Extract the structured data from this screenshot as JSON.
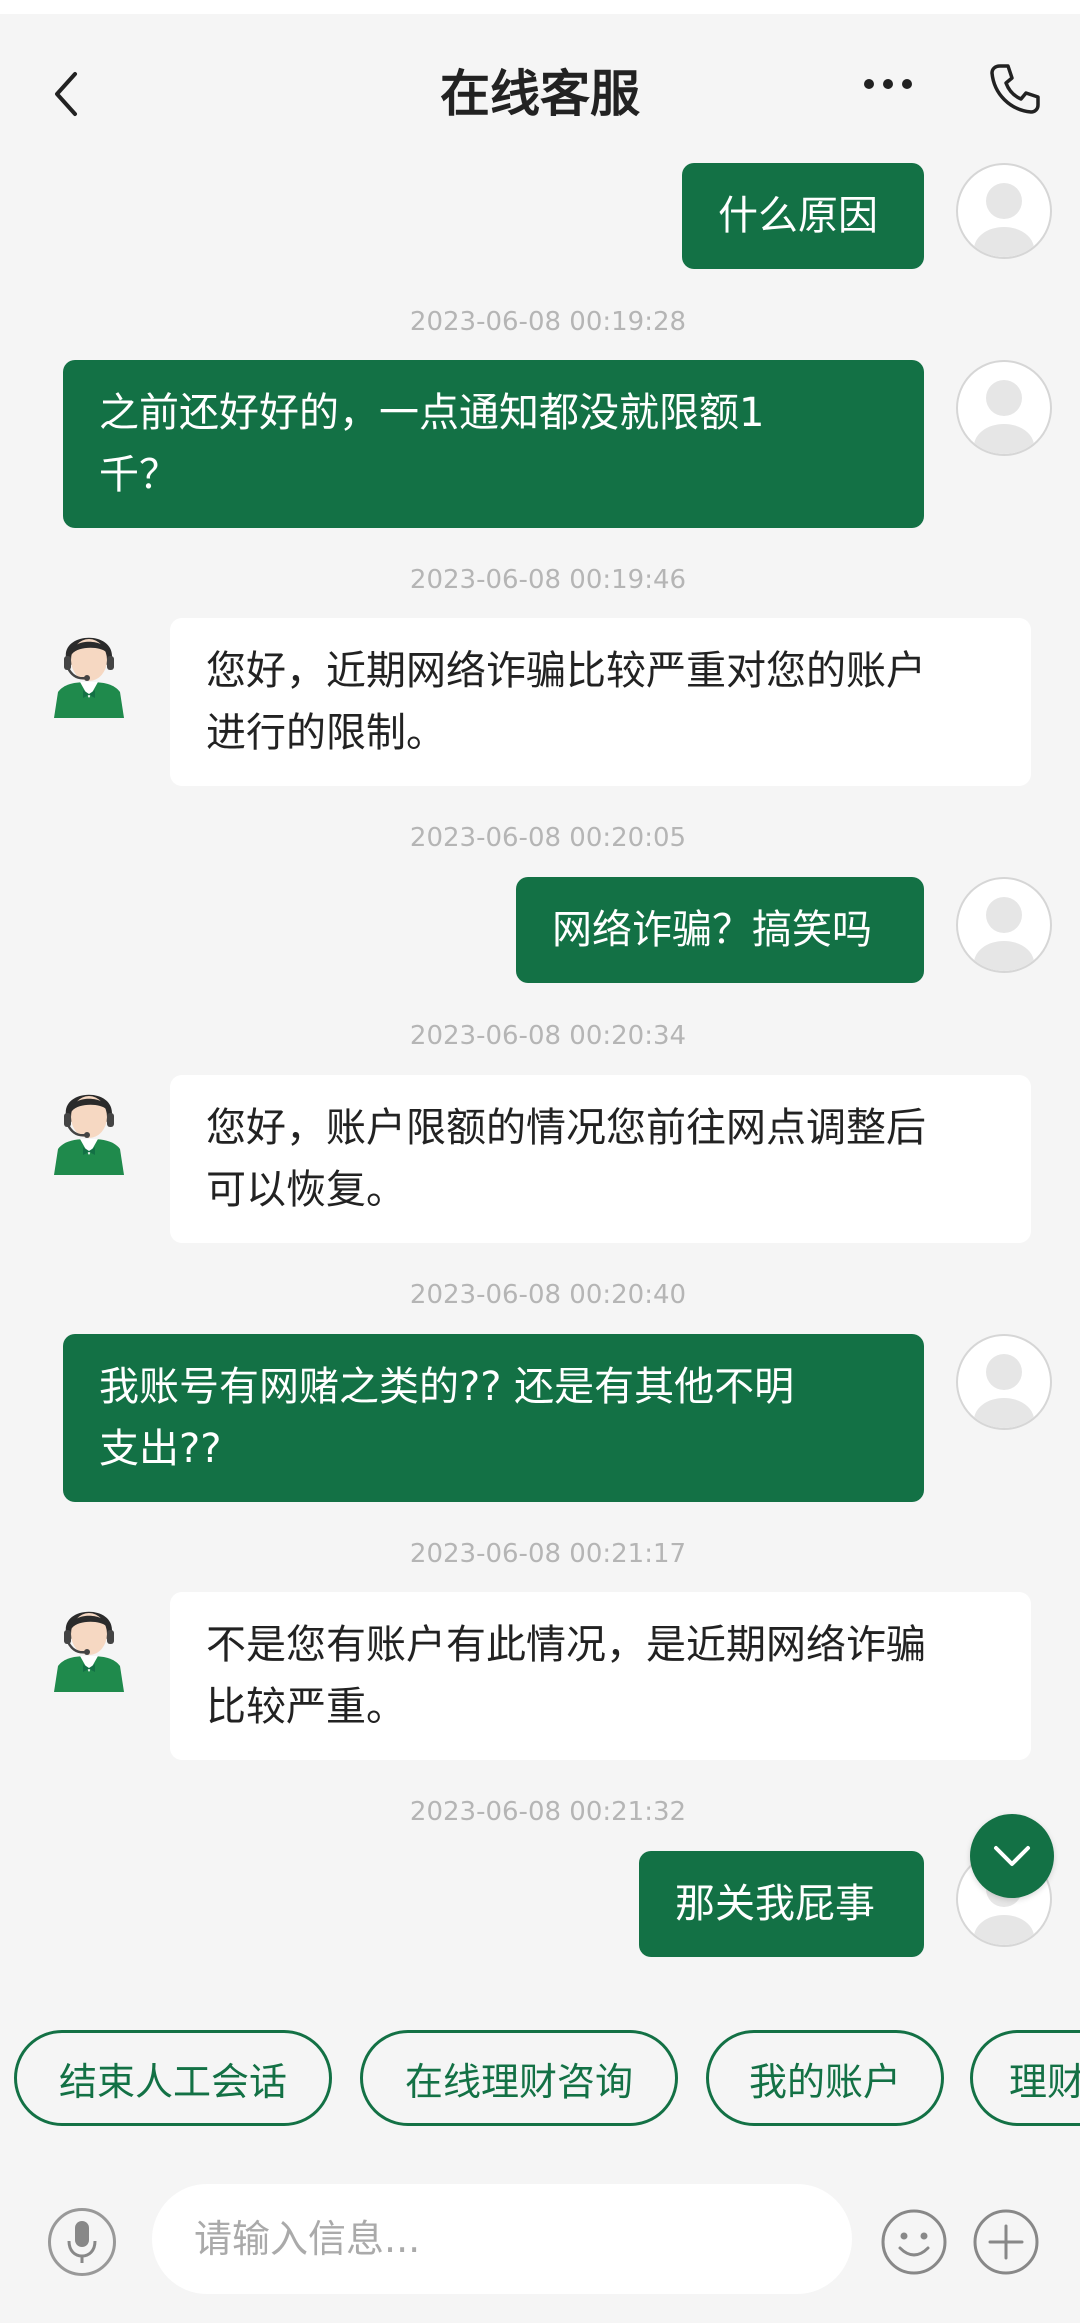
{
  "header": {
    "title": "在线客服"
  },
  "messages": [
    {
      "side": "right",
      "text": "什么原因"
    },
    {
      "timestamp": "2023-06-08 00:19:28"
    },
    {
      "side": "right",
      "text": "之前还好好的，一点通知都没就限额1千？"
    },
    {
      "timestamp": "2023-06-08 00:19:46"
    },
    {
      "side": "left",
      "text": "您好，近期网络诈骗比较严重对您的账户进行的限制。"
    },
    {
      "timestamp": "2023-06-08 00:20:05"
    },
    {
      "side": "right",
      "text": "网络诈骗？搞笑吗"
    },
    {
      "timestamp": "2023-06-08 00:20:34"
    },
    {
      "side": "left",
      "text": "您好，账户限额的情况您前往网点调整后可以恢复。"
    },
    {
      "timestamp": "2023-06-08 00:20:40"
    },
    {
      "side": "right",
      "text": "我账号有网赌之类的?? 还是有其他不明支出??"
    },
    {
      "timestamp": "2023-06-08 00:21:17"
    },
    {
      "side": "left",
      "text": "不是您有账户有此情况，是近期网络诈骗比较严重。"
    },
    {
      "timestamp": "2023-06-08 00:21:32"
    },
    {
      "side": "right",
      "text": "那关我屁事"
    }
  ],
  "m": {
    "r1": "什么原因",
    "t1": "2023-06-08 00:19:28",
    "r2a": "之前还好好的，一点通知都没就限额1",
    "r2b": "千？",
    "t2": "2023-06-08 00:19:46",
    "l1a": "您好，近期网络诈骗比较严重对您的账户",
    "l1b": "进行的限制。",
    "t3": "2023-06-08 00:20:05",
    "r3": "网络诈骗？搞笑吗",
    "t4": "2023-06-08 00:20:34",
    "l2a": "您好，账户限额的情况您前往网点调整后",
    "l2b": "可以恢复。",
    "t5": "2023-06-08 00:20:40",
    "r4a": "我账号有网赌之类的?? 还是有其他不明",
    "r4b": "支出??",
    "t6": "2023-06-08 00:21:17",
    "l3a": "不是您有账户有此情况，是近期网络诈骗",
    "l3b": "比较严重。",
    "t7": "2023-06-08 00:21:32",
    "r5": "那关我屁事"
  },
  "quick_replies": [
    "结束人工会话",
    "在线理财咨询",
    "我的账户",
    "理财"
  ],
  "input": {
    "placeholder": "请输入信息..."
  },
  "colors": {
    "brand_green": "#137145",
    "background": "#f5f5f5",
    "bubble_agent": "#ffffff",
    "timestamp": "#b5b5b5"
  },
  "icons": {
    "back": "chevron-left-icon",
    "more": "more-dots-icon",
    "call": "phone-icon",
    "scroll": "chevron-down-icon",
    "mic": "microphone-icon",
    "emoji": "smiley-icon",
    "plus": "plus-icon"
  }
}
